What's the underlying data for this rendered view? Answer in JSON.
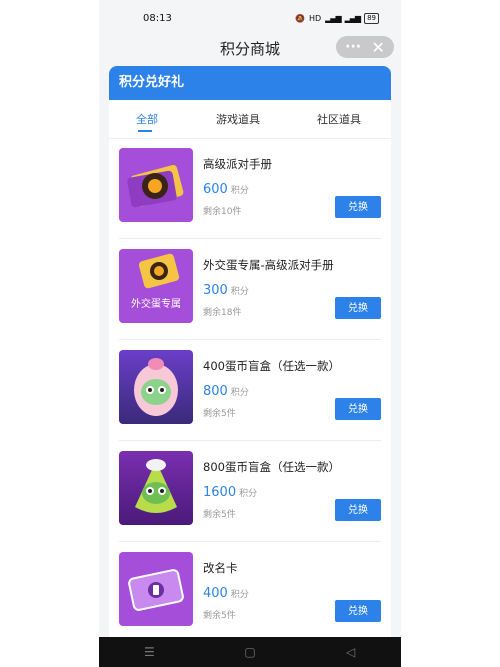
{
  "status": {
    "time": "08:13",
    "network": "HD",
    "battery": "89"
  },
  "nav": {
    "title": "积分商城"
  },
  "card": {
    "header": "积分兑好礼"
  },
  "tabs": [
    {
      "label": "全部"
    },
    {
      "label": "游戏道具"
    },
    {
      "label": "社区道具"
    }
  ],
  "colors": {
    "accent": "#2d82ea",
    "thumb": "#a44ed9"
  },
  "items": [
    {
      "name": "高级派对手册",
      "points": "600",
      "unit": "积分",
      "stock": "剩余10件",
      "button": "兑换",
      "icon": "party-handbook-icon"
    },
    {
      "name": "外交蛋专属-高级派对手册",
      "points": "300",
      "unit": "积分",
      "stock": "剩余18件",
      "button": "兑换",
      "icon": "party-handbook-icon",
      "thumb_text": "外交蛋专属"
    },
    {
      "name": "400蛋币盲盒（任选一款）",
      "points": "800",
      "unit": "积分",
      "stock": "剩余5件",
      "button": "兑换",
      "icon": "egg-character-icon"
    },
    {
      "name": "800蛋币盲盒（任选一款）",
      "points": "1600",
      "unit": "积分",
      "stock": "剩余5件",
      "button": "兑换",
      "icon": "egg-character-icon"
    },
    {
      "name": "改名卡",
      "points": "400",
      "unit": "积分",
      "stock": "剩余5件",
      "button": "兑换",
      "icon": "rename-card-icon"
    }
  ]
}
